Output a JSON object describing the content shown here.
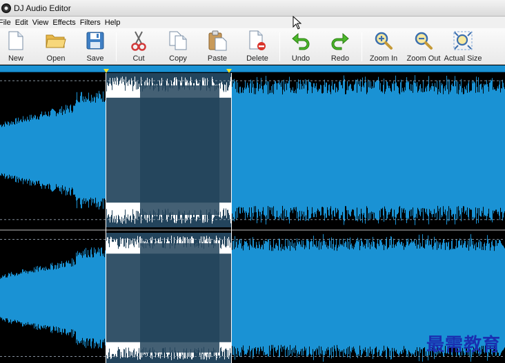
{
  "window": {
    "title": "DJ Audio Editor"
  },
  "menu": {
    "items": [
      "File",
      "Edit",
      "View",
      "Effects",
      "Filters",
      "Help"
    ]
  },
  "toolbar": {
    "new": "New",
    "open": "Open",
    "save": "Save",
    "cut": "Cut",
    "copy": "Copy",
    "paste": "Paste",
    "delete": "Delete",
    "undo": "Undo",
    "redo": "Redo",
    "zoom_in": "Zoom In",
    "zoom_out": "Zoom Out",
    "actual_size": "Actual Size"
  },
  "colors": {
    "wave": "#1a92d4",
    "selection": "#23445c",
    "selection_wave": "#ffffff",
    "background": "#000000",
    "marker": "#f5e52a"
  },
  "watermark": "最需教育"
}
